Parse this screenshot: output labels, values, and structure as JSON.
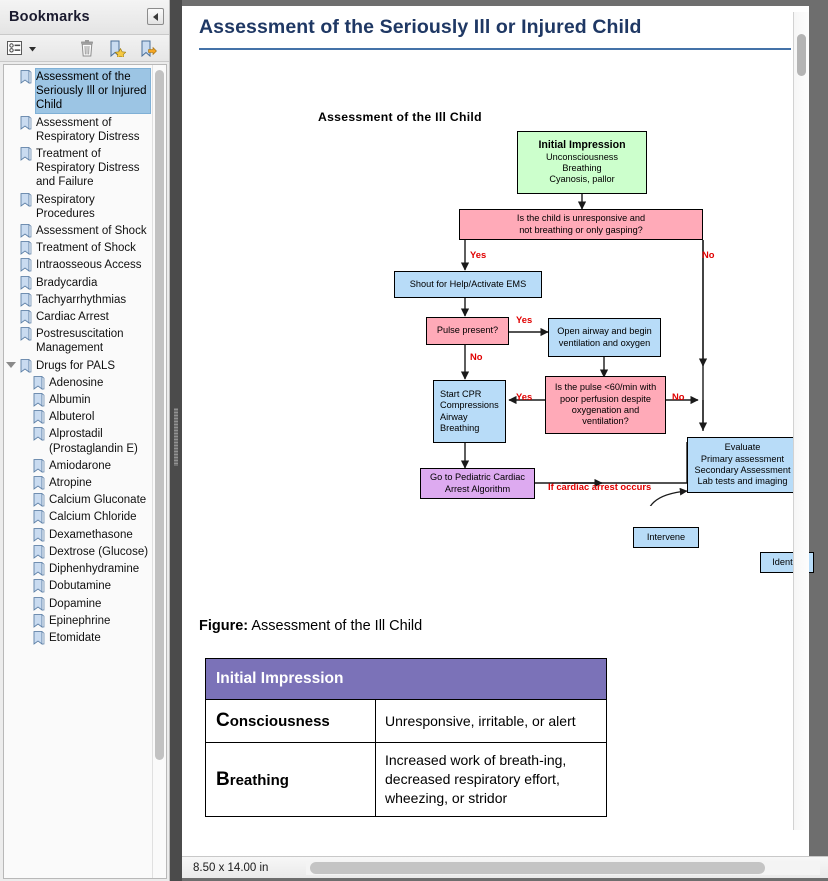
{
  "sidebar": {
    "title": "Bookmarks",
    "collapse_icon": "collapse-left-icon",
    "toolbar": {
      "options_icon": "bookmark-options-icon",
      "options_caret_icon": "chevron-down-icon",
      "delete_icon": "trash-icon",
      "new_bookmark_icon": "new-bookmark-icon",
      "goto_bookmark_icon": "goto-bookmark-icon"
    },
    "items": [
      {
        "label": "Assessment of the Seriously Ill or Injured Child",
        "selected": true,
        "level": 0,
        "twisty": ""
      },
      {
        "label": "Assessment of Respiratory Distress",
        "selected": false,
        "level": 0,
        "twisty": ""
      },
      {
        "label": "Treatment of Respiratory Distress and Failure",
        "selected": false,
        "level": 0,
        "twisty": ""
      },
      {
        "label": "Respiratory Procedures",
        "selected": false,
        "level": 0,
        "twisty": ""
      },
      {
        "label": "Assessment of Shock",
        "selected": false,
        "level": 0,
        "twisty": ""
      },
      {
        "label": "Treatment of Shock",
        "selected": false,
        "level": 0,
        "twisty": ""
      },
      {
        "label": "Intraosseous Access",
        "selected": false,
        "level": 0,
        "twisty": ""
      },
      {
        "label": "Bradycardia",
        "selected": false,
        "level": 0,
        "twisty": ""
      },
      {
        "label": "Tachyarrhythmias",
        "selected": false,
        "level": 0,
        "twisty": ""
      },
      {
        "label": "Cardiac Arrest",
        "selected": false,
        "level": 0,
        "twisty": ""
      },
      {
        "label": "Postresuscitation Management",
        "selected": false,
        "level": 0,
        "twisty": ""
      },
      {
        "label": "Drugs for PALS",
        "selected": false,
        "level": 0,
        "twisty": "down"
      },
      {
        "label": "Adenosine",
        "selected": false,
        "level": 1,
        "twisty": ""
      },
      {
        "label": "Albumin",
        "selected": false,
        "level": 1,
        "twisty": ""
      },
      {
        "label": "Albuterol",
        "selected": false,
        "level": 1,
        "twisty": ""
      },
      {
        "label": "Alprostadil (Prostaglandin E)",
        "selected": false,
        "level": 1,
        "twisty": ""
      },
      {
        "label": "Amiodarone",
        "selected": false,
        "level": 1,
        "twisty": ""
      },
      {
        "label": "Atropine",
        "selected": false,
        "level": 1,
        "twisty": ""
      },
      {
        "label": "Calcium Gluconate",
        "selected": false,
        "level": 1,
        "twisty": ""
      },
      {
        "label": "Calcium Chloride",
        "selected": false,
        "level": 1,
        "twisty": ""
      },
      {
        "label": "Dexamethasone",
        "selected": false,
        "level": 1,
        "twisty": ""
      },
      {
        "label": "Dextrose (Glucose)",
        "selected": false,
        "level": 1,
        "twisty": ""
      },
      {
        "label": "Diphenhydramine",
        "selected": false,
        "level": 1,
        "twisty": ""
      },
      {
        "label": "Dobutamine",
        "selected": false,
        "level": 1,
        "twisty": ""
      },
      {
        "label": "Dopamine",
        "selected": false,
        "level": 1,
        "twisty": ""
      },
      {
        "label": "Epinephrine",
        "selected": false,
        "level": 1,
        "twisty": ""
      },
      {
        "label": "Etomidate",
        "selected": false,
        "level": 1,
        "twisty": ""
      }
    ]
  },
  "document": {
    "title": "Assessment of the Seriously Ill or Injured Child",
    "title_color": "#1f3864",
    "rule_color": "#4472a8",
    "figure_caption_bold": "Figure:",
    "figure_caption_text": " Assessment of the Ill Child"
  },
  "chart_data": {
    "type": "diagram",
    "title": "Assessment of the Ill Child",
    "nodes": [
      {
        "id": "initial",
        "color": "#ccffcc",
        "header": "Initial Impression",
        "lines": [
          "Unconsciousness",
          "Breathing",
          "Cyanosis, pallor"
        ]
      },
      {
        "id": "decision1",
        "color": "#ffaab8",
        "header": "",
        "lines": [
          "Is the child is unresponsive and",
          "not breathing or only gasping?"
        ]
      },
      {
        "id": "shout",
        "color": "#b8dcf8",
        "header": "",
        "lines": [
          "Shout for Help/Activate EMS"
        ]
      },
      {
        "id": "pulse",
        "color": "#ffaab8",
        "header": "",
        "lines": [
          "Pulse present?"
        ]
      },
      {
        "id": "airway",
        "color": "#b8dcf8",
        "header": "",
        "lines": [
          "Open airway and begin",
          "ventilation and oxygen"
        ]
      },
      {
        "id": "cpr",
        "color": "#b8dcf8",
        "header": "",
        "lines": [
          "Start CPR",
          "Compressions",
          "Airway",
          "Breathing"
        ]
      },
      {
        "id": "pulse60",
        "color": "#ffaab8",
        "header": "",
        "lines": [
          "Is the pulse <60/min with",
          "poor perfusion despite",
          "oxygenation and",
          "ventilation?"
        ]
      },
      {
        "id": "goto",
        "color": "#ddaaf0",
        "header": "",
        "lines": [
          "Go to Pediatric Cardiac",
          "Arrest Algorithm"
        ]
      },
      {
        "id": "evaluate",
        "color": "#b8dcf8",
        "header": "",
        "lines": [
          "Evaluate",
          "Primary assessment",
          "Secondary Assessment",
          "Lab tests and imaging"
        ]
      },
      {
        "id": "intervene",
        "color": "#b8dcf8",
        "header": "",
        "lines": [
          "Intervene"
        ]
      },
      {
        "id": "identify",
        "color": "#b8dcf8",
        "header": "",
        "lines": [
          "Identify"
        ]
      }
    ],
    "edge_labels": [
      {
        "text": "Yes",
        "color": "#e00000"
      },
      {
        "text": "No",
        "color": "#e00000"
      },
      {
        "text": "Yes",
        "color": "#e00000"
      },
      {
        "text": "No",
        "color": "#e00000"
      },
      {
        "text": "Yes",
        "color": "#e00000"
      },
      {
        "text": "No",
        "color": "#e00000"
      },
      {
        "text": "If cardiac arrest occurs",
        "color": "#e00000"
      }
    ]
  },
  "table": {
    "header": "Initial Impression",
    "header_bg": "#7b72b8",
    "rows": [
      {
        "term_cap": "C",
        "term_rest": "onsciousness",
        "desc": "Unresponsive, irritable, or alert"
      },
      {
        "term_cap": "B",
        "term_rest": "reathing",
        "desc": "Increased work of breath-ing, decreased respiratory effort, wheezing, or stridor"
      }
    ]
  },
  "statusbar": {
    "page_size": "8.50 x 14.00 in"
  }
}
